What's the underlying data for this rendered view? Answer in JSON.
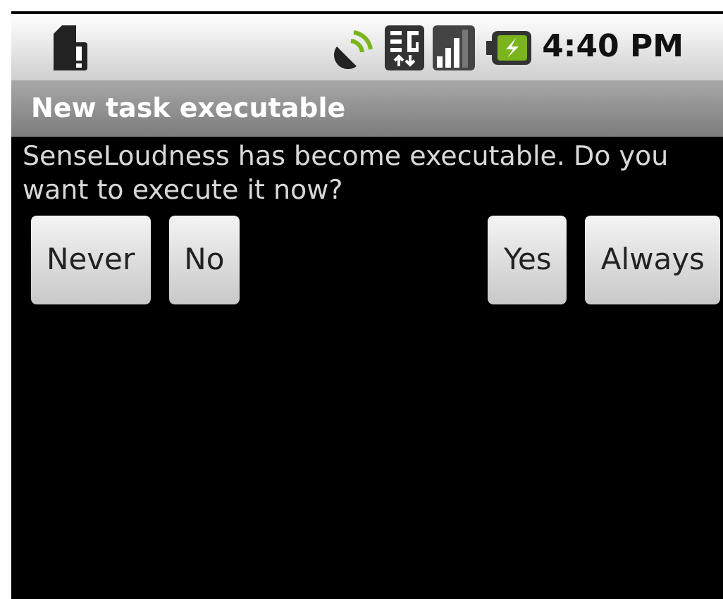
{
  "status_bar": {
    "time": "4:40 PM"
  },
  "dialog": {
    "title": "New task executable",
    "message": "SenseLoudness has become executable. Do you want to execute it now?",
    "buttons_left": [
      {
        "label": "Never"
      },
      {
        "label": "No"
      }
    ],
    "buttons_right": [
      {
        "label": "Yes"
      },
      {
        "label": "Always"
      }
    ]
  }
}
